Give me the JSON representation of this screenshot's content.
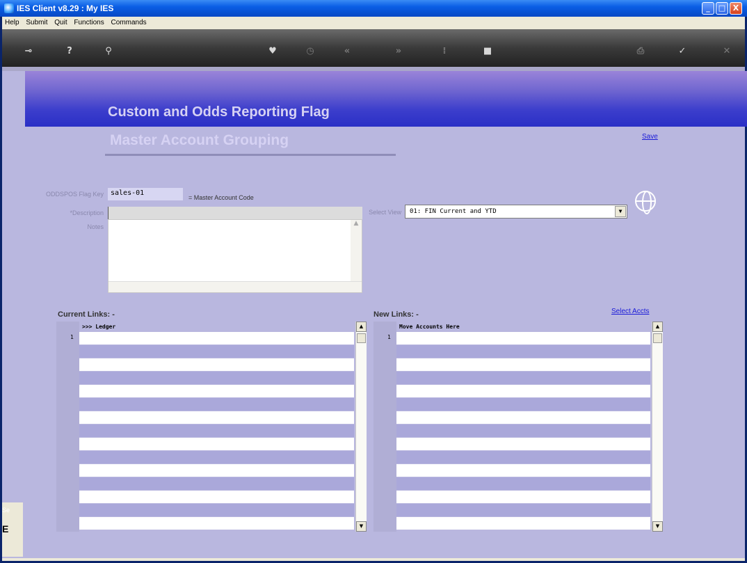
{
  "window": {
    "title": "IES Client v8.29 : My IES",
    "minimize": "_",
    "maximize": "□",
    "close": "X"
  },
  "menu": [
    "Help",
    "Submit",
    "Quit",
    "Functions",
    "Commands"
  ],
  "toolbar": {
    "icons": [
      "key-icon",
      "help-icon",
      "search-icon",
      "heart-icon",
      "clock-icon",
      "rewind-icon",
      "forward-icon",
      "spacer-icon",
      "stop-icon",
      "print-icon",
      "check-icon",
      "close-icon"
    ]
  },
  "header": {
    "title": "Custom and Odds Reporting Flag",
    "subtitle": "Master Account Grouping",
    "save": "Save"
  },
  "form": {
    "flag_key_label": "ODDSPOS Flag Key",
    "flag_key_value": "sales-01",
    "flag_key_hint": "= Master Account Code",
    "description_label": "*Description",
    "notes_label": "Notes",
    "select_view_label": "Select View",
    "select_view_value": "01: FIN Current and YTD"
  },
  "current_links": {
    "title": "Current Links: -",
    "header": ">>> Ledger",
    "row_number": "1"
  },
  "new_links": {
    "title": "New Links: -",
    "header": "Move Accounts Here",
    "row_number": "1",
    "select_accts": "Select Accts"
  },
  "sidebar": {
    "top": "Se",
    "bottom": "E"
  }
}
